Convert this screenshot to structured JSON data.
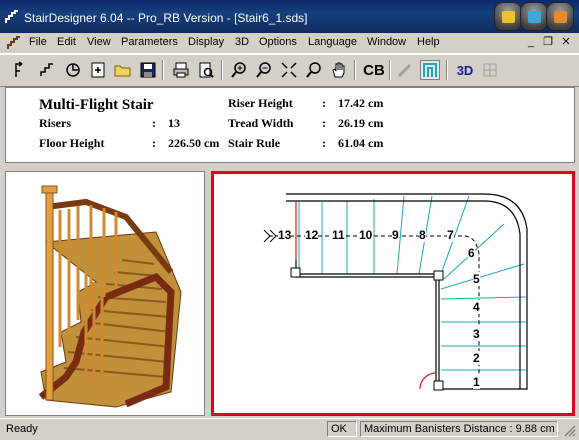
{
  "app": {
    "title": "StairDesigner 6.04 -- Pro_RB Version - [Stair6_1.sds]"
  },
  "menu": [
    "File",
    "Edit",
    "View",
    "Parameters",
    "Display",
    "3D",
    "Options",
    "Language",
    "Window",
    "Help"
  ],
  "window_controls": {
    "minimize": "_",
    "restore": "❐",
    "close": "✕"
  },
  "toolbar": {
    "icons": [
      "new-stair-icon",
      "draw-line-icon",
      "rotate-icon",
      "import-icon",
      "open-folder-icon",
      "save-icon",
      "print-icon",
      "print-preview-icon",
      "zoom-in-icon",
      "zoom-out-icon",
      "zoom-fit-icon",
      "zoom-window-icon",
      "pan-hand-icon",
      "cb-icon",
      "pencil-icon",
      "stair-view-icon",
      "3d-view-icon",
      "grid-icon"
    ],
    "cb_label": "CB",
    "3d_label": "3D"
  },
  "info": {
    "title": "Multi-Flight Stair",
    "risers_label": "Risers",
    "risers_value": "13",
    "floor_height_label": "Floor Height",
    "floor_height_value": "226.50 cm",
    "riser_height_label": "Riser Height",
    "riser_height_value": "17.42 cm",
    "tread_width_label": "Tread Width",
    "tread_width_value": "26.19 cm",
    "stair_rule_label": "Stair Rule",
    "stair_rule_value": "61.04 cm",
    "colon": ":"
  },
  "plan": {
    "step_numbers": [
      "1",
      "2",
      "3",
      "4",
      "5",
      "6",
      "7",
      "8",
      "9",
      "10",
      "11",
      "12",
      "13"
    ]
  },
  "status": {
    "left": "Ready",
    "ok": "OK",
    "banisters": "Maximum Banisters Distance : 9.88 cm"
  },
  "colors": {
    "title_bar": "#0d2a5c",
    "plan_border": "#e3001b",
    "tread_line": "#1aa8b8",
    "wood": "#b06a22",
    "carpet": "#c0903a"
  }
}
